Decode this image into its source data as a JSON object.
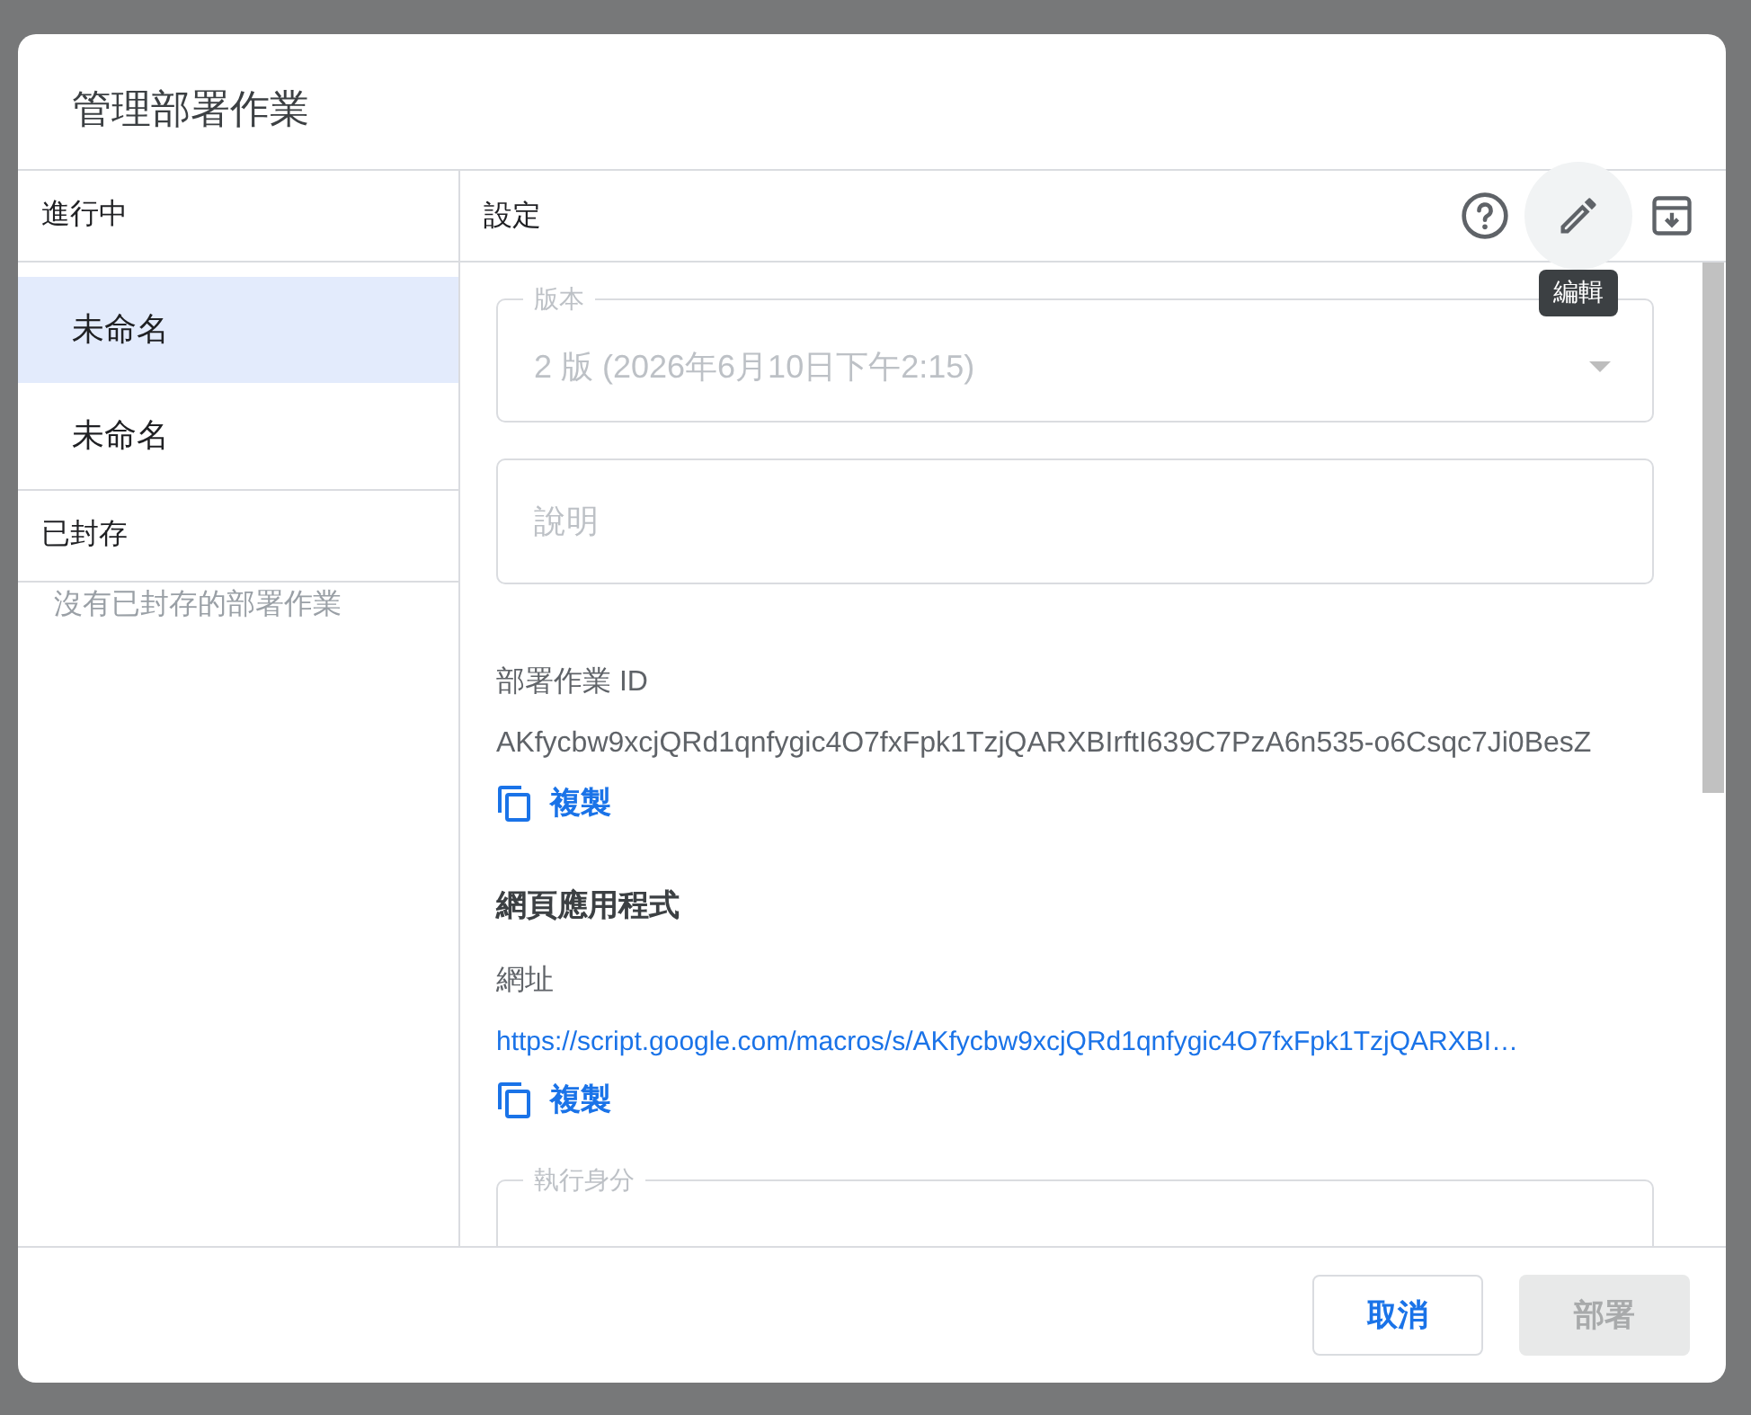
{
  "dialog": {
    "title": "管理部署作業"
  },
  "sidebar": {
    "sections": [
      {
        "heading": "進行中",
        "items": [
          {
            "label": "未命名",
            "selected": true
          },
          {
            "label": "未命名",
            "selected": false
          }
        ]
      },
      {
        "heading": "已封存",
        "empty_text": "沒有已封存的部署作業"
      }
    ]
  },
  "settings": {
    "heading": "設定",
    "tooltip": "編輯",
    "version_field": {
      "label": "版本",
      "value": "2 版 (2026年6月10日下午2:15)",
      "disabled": true
    },
    "description_field": {
      "placeholder": "說明"
    },
    "deployment_id": {
      "label": "部署作業 ID",
      "value": "AKfycbw9xcjQRd1qnfygic4O7fxFpk1TzjQARXBIrftI639C7PzA6n535-o6Csqc7Ji0BesZ",
      "copy_label": "複製"
    },
    "web_app": {
      "heading": "網頁應用程式",
      "url_label": "網址",
      "url": "https://script.google.com/macros/s/AKfycbw9xcjQRd1qnfygic4O7fxFpk1TzjQARXBI…",
      "copy_label": "複製"
    },
    "execute_as": {
      "label": "執行身分"
    }
  },
  "buttons": [
    {
      "label": "取消",
      "disabled": false
    },
    {
      "label": "部署",
      "disabled": true
    }
  ]
}
